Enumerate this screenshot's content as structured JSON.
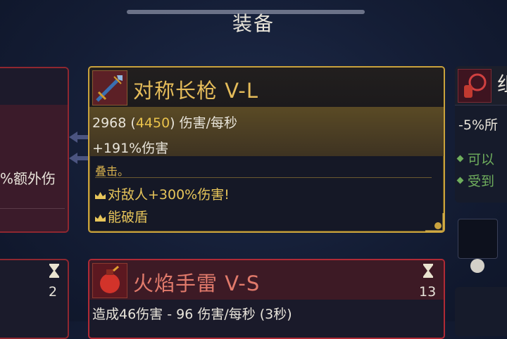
{
  "header": {
    "title": "装备"
  },
  "left_card": {
    "partial_text": "%额外伤"
  },
  "weapon_card": {
    "name": "对称长枪 V-L",
    "dps_base": "2968",
    "dps_open": " (",
    "dps_highlight": "4450",
    "dps_suffix": ") 伤害/每秒",
    "damage_bonus": "+191%伤害",
    "stacking": "叠击。",
    "effects": [
      "对敌人+300%伤害!",
      "能破盾"
    ],
    "name_color": "#e5bc5a",
    "border_color": "#c9a23c"
  },
  "right_card": {
    "partial_name": "组",
    "stat": "-5%所",
    "lines": [
      "可以",
      "受到"
    ]
  },
  "grenade_card": {
    "name": "火焰手雷 V-S",
    "description": "造成46伤害 - 96 伤害/每秒 (3秒)",
    "cooldown": "13",
    "border_color": "#b02a35"
  },
  "left_bottom": {
    "cooldown": "2"
  },
  "icons": [
    "hourglass-icon",
    "spear-icon",
    "grenade-icon",
    "crown-icon",
    "swap-arrows-icon"
  ]
}
